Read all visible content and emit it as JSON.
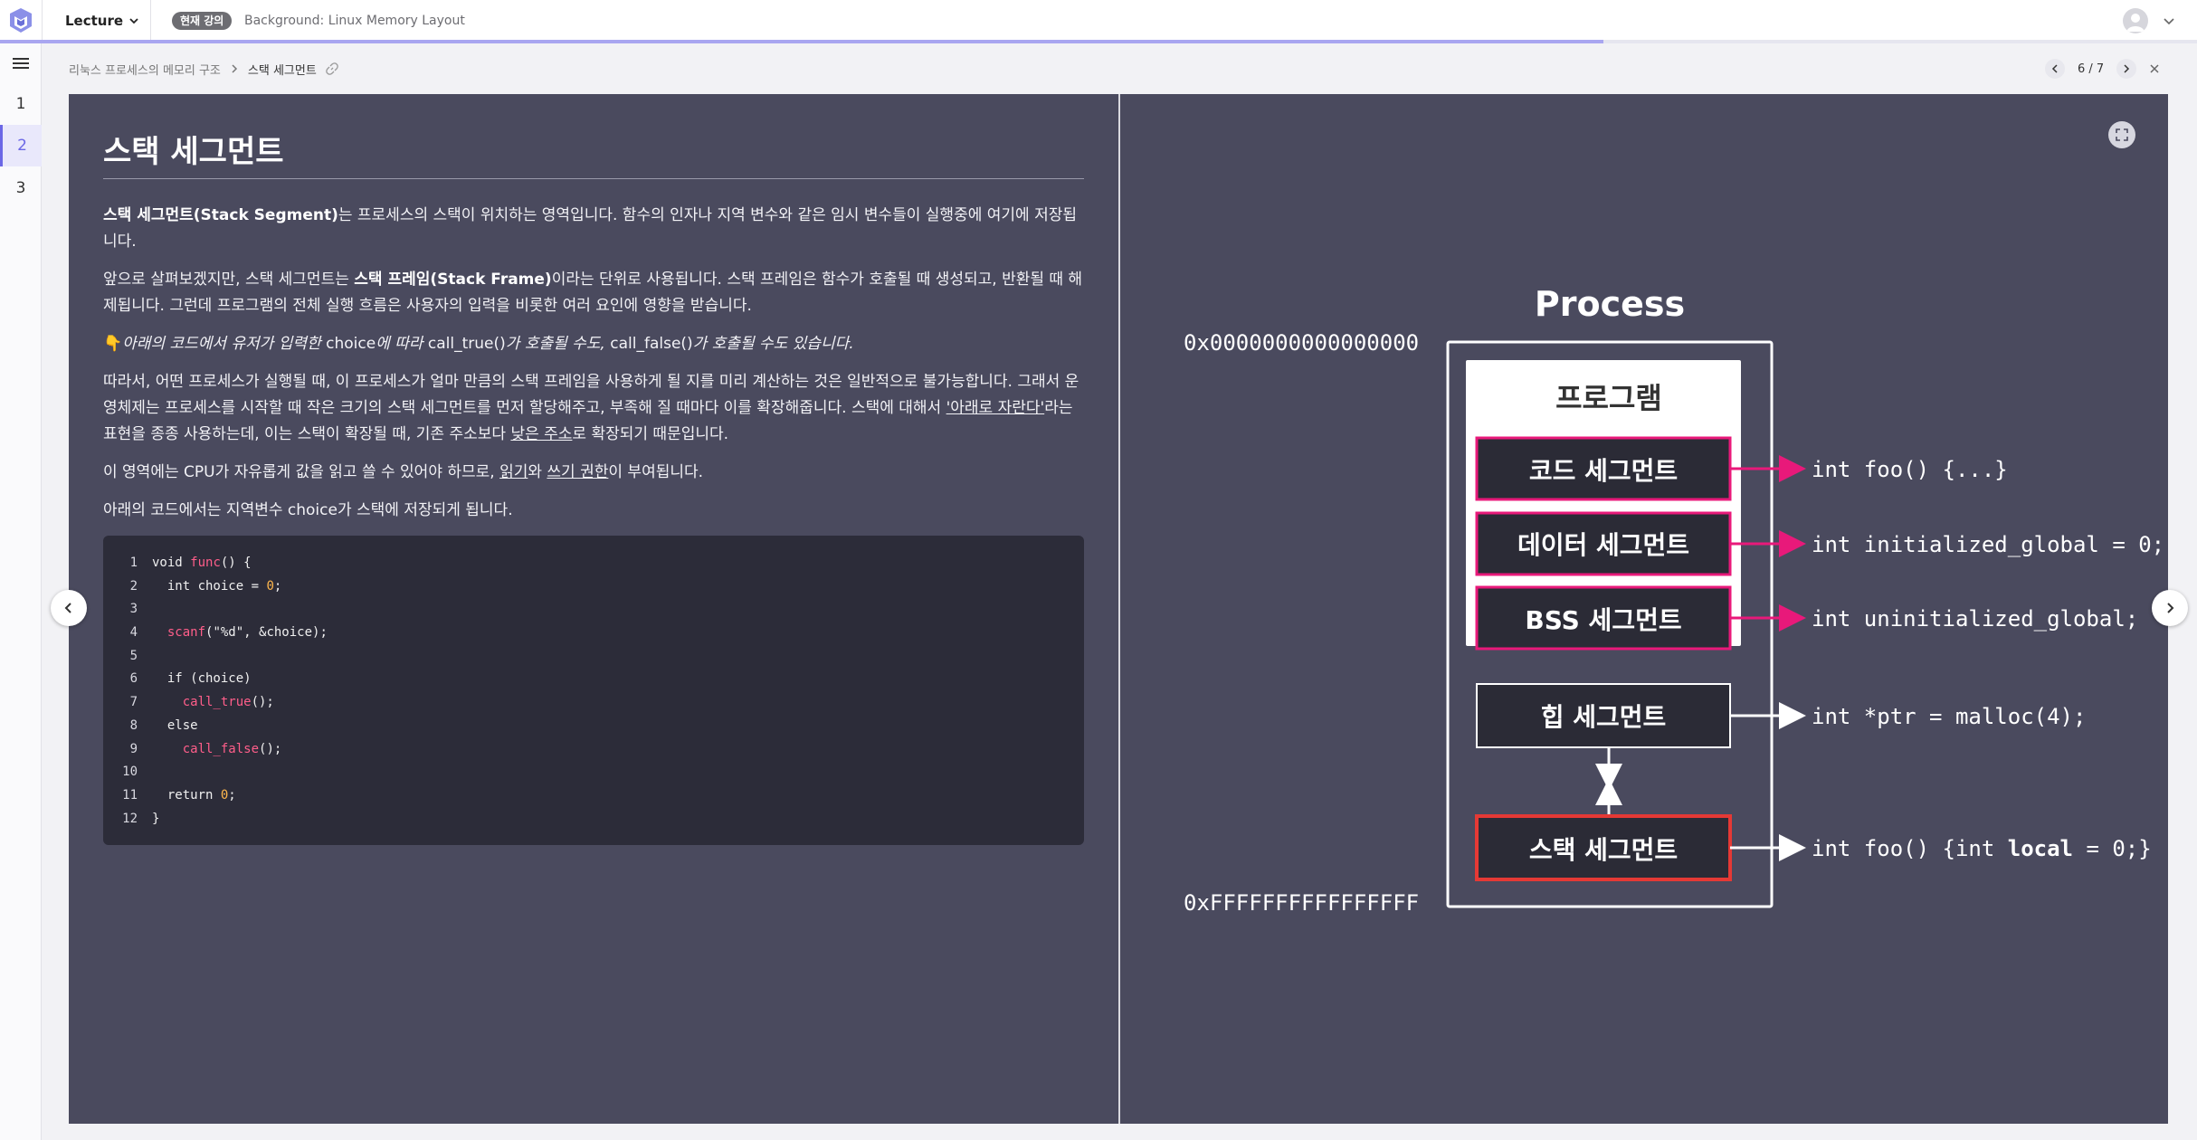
{
  "topbar": {
    "lecture_label": "Lecture",
    "badge": "현재 강의",
    "title": "Background: Linux Memory Layout",
    "progress_percent": 73
  },
  "rail": {
    "items": [
      "1",
      "2",
      "3"
    ],
    "active_index": 1
  },
  "breadcrumb": {
    "parent": "리눅스 프로세스의 메모리 구조",
    "current": "스택 세그먼트"
  },
  "pager": {
    "text": "6 / 7"
  },
  "slide": {
    "heading": "스택 세그먼트",
    "p1_bold": "스택 세그먼트(Stack Segment)",
    "p1_rest": "는 프로세스의 스택이 위치하는 영역입니다. 함수의 인자나 지역 변수와 같은 임시 변수들이 실행중에 여기에 저장됩니다.",
    "p2_a": "앞으로 살펴보겠지만, 스택 세그먼트는 ",
    "p2_bold": "스택 프레임(Stack Frame)",
    "p2_b": "이라는 단위로 사용됩니다. 스택 프레임은 함수가 호출될 때 생성되고, 반환될 때 해제됩니다. 그런데 프로그램의 전체 실행 흐름은 사용자의 입력을 비롯한 여러 요인에 영향을 받습니다.",
    "p3_icon": "👇",
    "p3_a": "아래의 코드에서 유저가 입력한 ",
    "p3_b": "choice",
    "p3_c": "에 따라 ",
    "p3_d": "call_true()",
    "p3_e": "가 호출될 수도, ",
    "p3_f": "call_false()",
    "p3_g": "가 호출될 수도 있습니다.",
    "p4_a": "따라서, 어떤 프로세스가 실행될 때, 이 프로세스가 얼마 만큼의 스택 프레임을 사용하게 될 지를 미리 계산하는 것은 일반적으로 불가능합니다. 그래서 운영체제는 프로세스를 시작할 때 작은 크기의 스택 세그먼트를 먼저 할당해주고, 부족해 질 때마다 이를 확장해줍니다. 스택에 대해서 ",
    "p4_u1": "'아래로 자란다'",
    "p4_b": "라는 표현을 종종 사용하는데, 이는 스택이 확장될 때, 기존 주소보다 ",
    "p4_u2": "낮은 주소",
    "p4_c": "로 확장되기 때문입니다.",
    "p5_a": "이 영역에는 CPU가 자유롭게 값을 읽고 쓸 수 있어야 하므로, ",
    "p5_u1": "읽기",
    "p5_b": "와 ",
    "p5_u2": "쓰기 권한",
    "p5_c": "이 부여됩니다.",
    "p6": "아래의 코드에서는 지역변수 choice가 스택에 저장되게 됩니다.",
    "code": [
      {
        "n": "1",
        "parts": [
          [
            "void ",
            ""
          ],
          [
            "func",
            "kw"
          ],
          [
            "() {",
            ""
          ]
        ]
      },
      {
        "n": "2",
        "parts": [
          [
            "  int choice = ",
            ""
          ],
          [
            "0",
            "num"
          ],
          [
            ";",
            ""
          ]
        ]
      },
      {
        "n": "3",
        "parts": []
      },
      {
        "n": "4",
        "parts": [
          [
            "  ",
            ""
          ],
          [
            "scanf",
            "kw"
          ],
          [
            "(\"%d\", &choice);",
            ""
          ]
        ]
      },
      {
        "n": "5",
        "parts": []
      },
      {
        "n": "6",
        "parts": [
          [
            "  if (choice)",
            ""
          ]
        ]
      },
      {
        "n": "7",
        "parts": [
          [
            "    ",
            ""
          ],
          [
            "call_true",
            "kw"
          ],
          [
            "();",
            ""
          ]
        ]
      },
      {
        "n": "8",
        "parts": [
          [
            "  else",
            ""
          ]
        ]
      },
      {
        "n": "9",
        "parts": [
          [
            "    ",
            ""
          ],
          [
            "call_false",
            "kw"
          ],
          [
            "();",
            ""
          ]
        ]
      },
      {
        "n": "10",
        "parts": []
      },
      {
        "n": "11",
        "parts": [
          [
            "  return ",
            ""
          ],
          [
            "0",
            "num"
          ],
          [
            ";",
            ""
          ]
        ]
      },
      {
        "n": "12",
        "parts": [
          [
            "}",
            ""
          ]
        ]
      }
    ]
  },
  "diagram": {
    "title": "Process",
    "addr_low": "0x0000000000000000",
    "addr_high": "0xFFFFFFFFFFFFFFFF",
    "program_label": "프로그램",
    "segments": {
      "code": "코드 세그먼트",
      "data": "데이터 세그먼트",
      "bss": "BSS 세그먼트",
      "heap": "힙 세그먼트",
      "stack": "스택 세그먼트"
    },
    "labels": {
      "code": "int foo() {...}",
      "data": "int initialized_global = 0;",
      "bss": "int uninitialized_global;",
      "heap": "int *ptr = malloc(4);",
      "stack_a": "int foo() {int ",
      "stack_b": "local",
      "stack_c": " = 0;}"
    },
    "colors": {
      "pink": "#e8197a",
      "red": "#e53935",
      "box": "#2b2b36"
    }
  }
}
